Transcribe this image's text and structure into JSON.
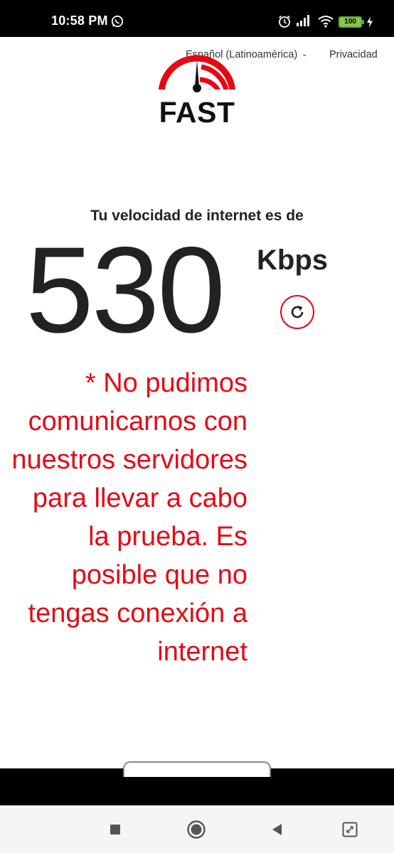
{
  "status_bar": {
    "time": "10:58 PM",
    "battery": "100",
    "icons": [
      "whatsapp-icon",
      "alarm-icon",
      "signal-icon",
      "wifi-icon",
      "battery-icon",
      "charging-bolt-icon"
    ]
  },
  "header": {
    "language": "Español (Latinoamérica)",
    "privacy": "Privacidad",
    "logo_text": "FAST"
  },
  "speed": {
    "heading": "Tu velocidad de internet es de",
    "value": "530",
    "unit": "Kbps"
  },
  "error": {
    "message": "* No pudimos comunicarnos con nuestros servidores para llevar a cabo la prueba. Es posible que no tengas conexión a internet"
  },
  "nav_bar": {
    "icons": [
      "recent-apps-icon",
      "home-icon",
      "back-icon",
      "assist-icon"
    ]
  },
  "colors": {
    "accent": "#e50914",
    "text": "#222222",
    "status_bar_bg": "#000000",
    "battery": "#8bc34a"
  }
}
